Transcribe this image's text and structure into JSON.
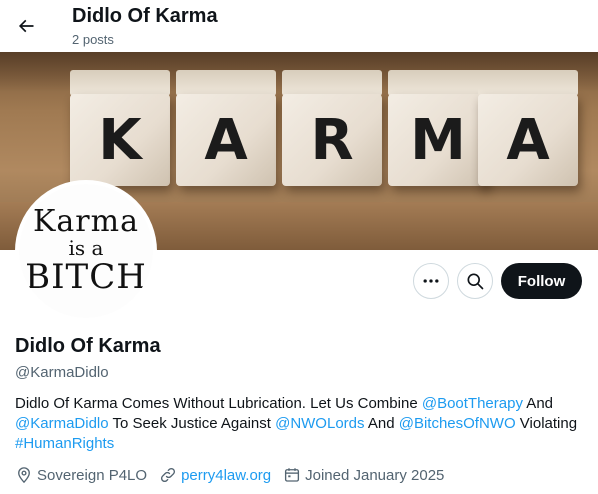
{
  "header": {
    "title": "Didlo Of Karma",
    "post_count": "2 posts"
  },
  "banner": {
    "letters": [
      "K",
      "A",
      "R",
      "M",
      "A"
    ]
  },
  "avatar": {
    "line1": "Karma",
    "line2": "is a",
    "line3": "BITCH"
  },
  "actions": {
    "follow_label": "Follow"
  },
  "profile": {
    "name": "Didlo Of Karma",
    "handle": "@KarmaDidlo",
    "bio": {
      "t1": "Didlo Of Karma Comes Without Lubrication. Let Us Combine ",
      "m1": "@BootTherapy",
      "t2": " And ",
      "m2": "@KarmaDidlo",
      "t3": " To Seek Justice Against ",
      "m3": "@NWOLords",
      "t4": " And ",
      "m4": "@BitchesOfNWO",
      "t5": " Violating ",
      "h1": "#HumanRights"
    },
    "location": "Sovereign P4LO",
    "website": "perry4law.org",
    "joined": "Joined January 2025"
  },
  "colors": {
    "link": "#1d9bf0",
    "secondary_text": "#536471",
    "primary_text": "#0f1419",
    "follow_bg": "#0f1419"
  },
  "icons": [
    "back-arrow-icon",
    "more-icon",
    "search-icon",
    "location-icon",
    "link-icon",
    "calendar-icon"
  ]
}
